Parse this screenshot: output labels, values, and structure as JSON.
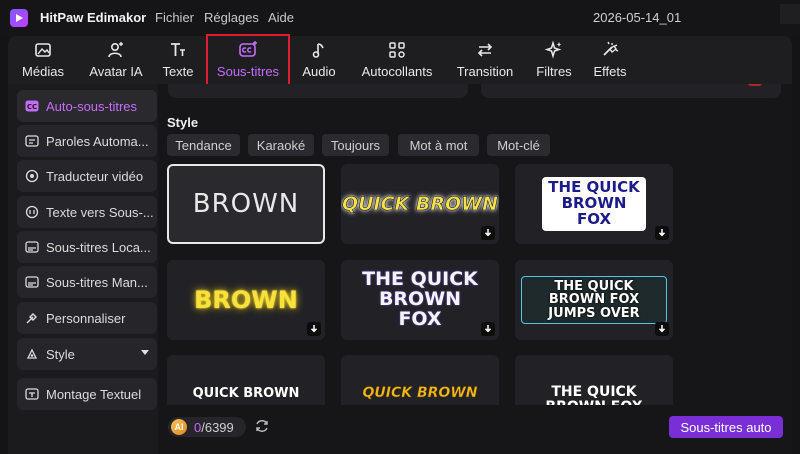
{
  "app": {
    "name": "HitPaw Edimakor",
    "project": "2026-05-14_01"
  },
  "menu": [
    "Fichier",
    "Réglages",
    "Aide"
  ],
  "toolbar": [
    {
      "label": "Médias",
      "icon": "media-icon"
    },
    {
      "label": "Avatar IA",
      "icon": "avatar-ai-icon"
    },
    {
      "label": "Texte",
      "icon": "text-icon"
    },
    {
      "label": "Sous-titres",
      "icon": "subtitles-icon",
      "active": true
    },
    {
      "label": "Audio",
      "icon": "audio-icon"
    },
    {
      "label": "Autocollants",
      "icon": "stickers-icon"
    },
    {
      "label": "Transition",
      "icon": "transition-icon"
    },
    {
      "label": "Filtres",
      "icon": "filters-icon"
    },
    {
      "label": "Effets",
      "icon": "effects-icon"
    }
  ],
  "sidebar": [
    {
      "label": "Auto-sous-titres",
      "icon": "cc-icon",
      "active": true
    },
    {
      "label": "Paroles Automa...",
      "icon": "lyrics-icon"
    },
    {
      "label": "Traducteur vidéo",
      "icon": "translate-icon"
    },
    {
      "label": "Texte vers Sous-...",
      "icon": "text-to-subtitle-icon"
    },
    {
      "label": "Sous-titres Loca...",
      "icon": "local-subtitles-icon"
    },
    {
      "label": "Sous-titres Man...",
      "icon": "manual-subtitles-icon"
    },
    {
      "label": "Personnaliser",
      "icon": "customize-icon"
    },
    {
      "label": "Style",
      "icon": "style-icon",
      "dropdown": true
    },
    {
      "label": "Montage Textuel",
      "icon": "text-edit-icon"
    }
  ],
  "style_section": {
    "title": "Style",
    "chips": [
      "Tendance",
      "Karaoké",
      "Toujours",
      "Mot à mot",
      "Mot-clé"
    ]
  },
  "presets": [
    {
      "text": "BROWN",
      "style": "plain",
      "selected": true
    },
    {
      "text": "QUICK BROWN",
      "style": "quick-yellow",
      "download": true
    },
    {
      "text": "THE QUICK BROWN FOX",
      "style": "blue-white-box",
      "download": true
    },
    {
      "text": "BROWN",
      "style": "neon-yellow",
      "download": true
    },
    {
      "text": "THE QUICK BROWN FOX",
      "style": "pink-highlight",
      "download": true
    },
    {
      "text": "THE QUICK BROWN FOX JUMPS OVER",
      "style": "green-highlight",
      "download": true
    },
    {
      "text": "QUICK BROWN",
      "style": "white-small"
    },
    {
      "text": "QUICK BROWN",
      "style": "yellow-italic"
    },
    {
      "text": "THE QUICK BROWN FOX JUMPS OVER",
      "style": "red-highlight"
    }
  ],
  "credits": {
    "coin_label": "AI",
    "used": "0",
    "total": "/6399"
  },
  "auto_button": "Sous-titres auto",
  "colors": {
    "accent": "#c56cff",
    "button": "#7a2fd6",
    "highlight_box": "#e11c2c"
  }
}
